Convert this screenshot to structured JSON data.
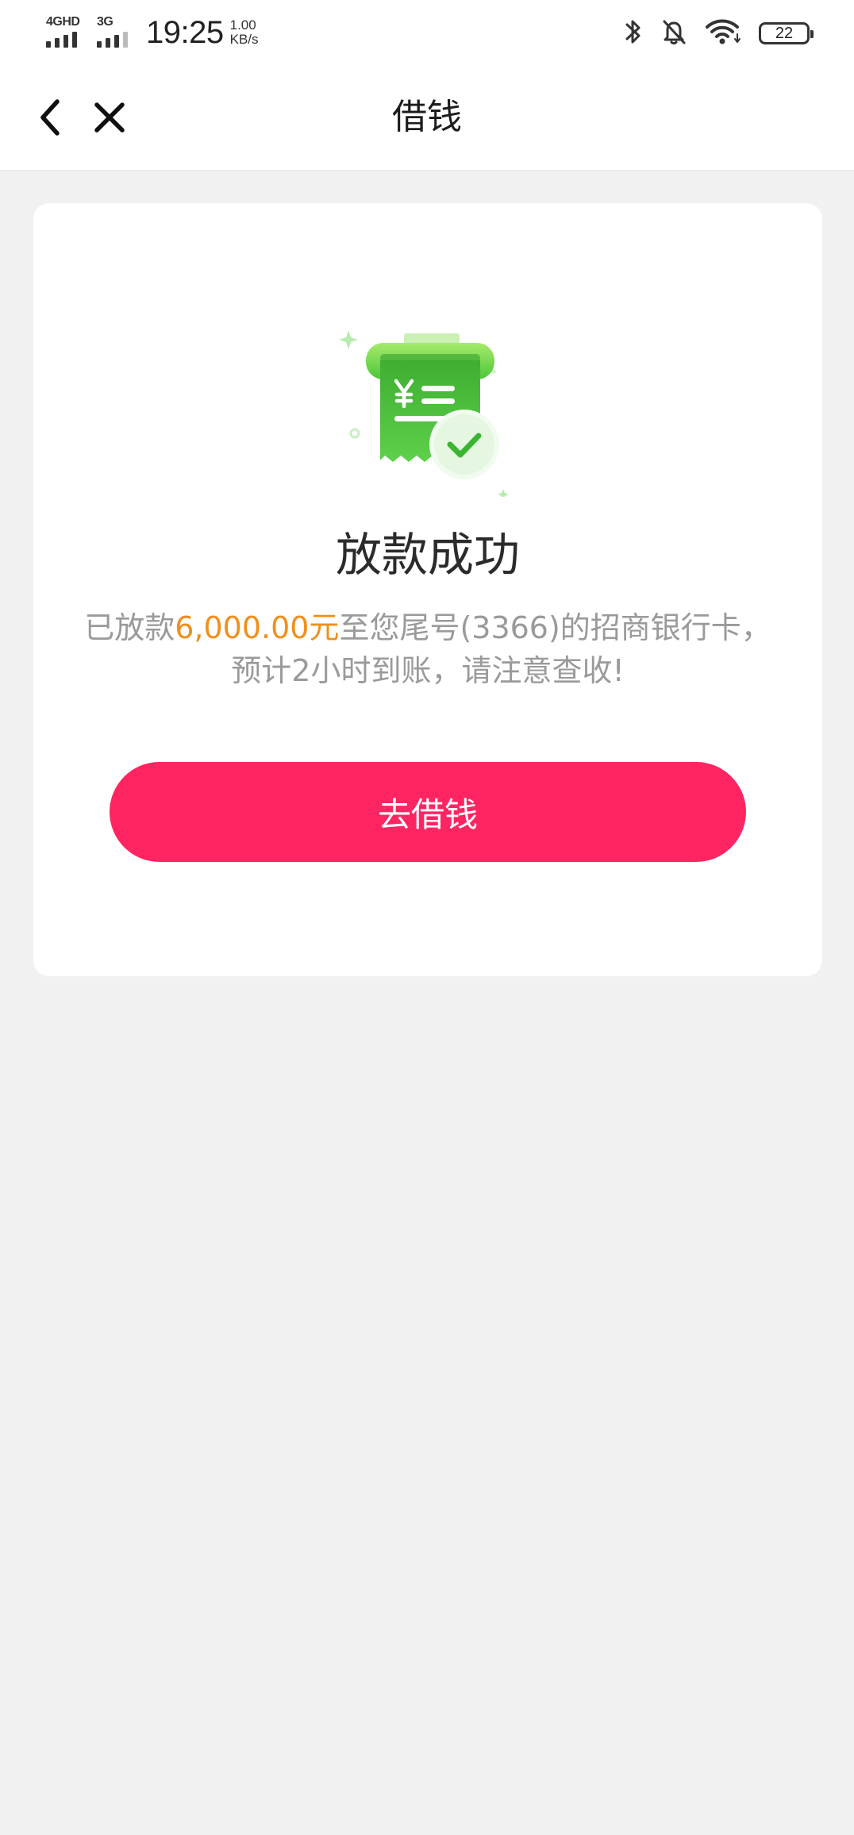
{
  "status_bar": {
    "network_1": "4GHD",
    "network_2": "3G",
    "time": "19:25",
    "speed_value": "1.00",
    "speed_unit": "KB/s",
    "battery_level": "22",
    "icons": [
      "bluetooth-icon",
      "mute-bell-icon",
      "wifi-icon",
      "battery-icon"
    ]
  },
  "nav": {
    "title": "借钱",
    "back_icon": "chevron-left-icon",
    "close_icon": "close-icon"
  },
  "result": {
    "illustration_icon": "receipt-check-icon",
    "title": "放款成功",
    "desc_prefix": "已放款",
    "amount": "6,000.00元",
    "desc_suffix": "至您尾号(3366)的招商银行卡，预计2小时到账，请注意查收!",
    "button_label": "去借钱"
  },
  "colors": {
    "accent_button": "#ff2462",
    "amount_text": "#f0901a",
    "success_green": "#4cc63a",
    "background": "#f1f1f1"
  }
}
